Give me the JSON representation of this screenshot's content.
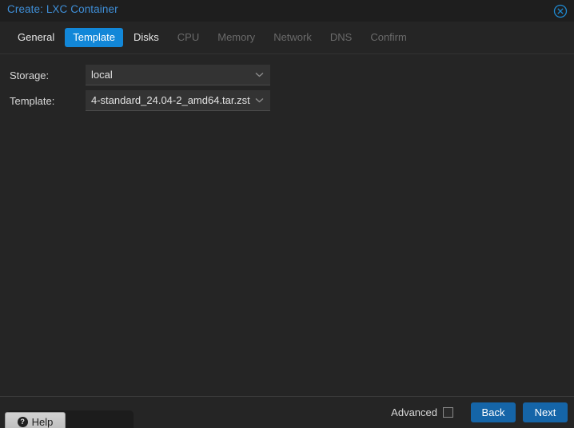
{
  "window": {
    "title": "Create: LXC Container",
    "close_icon": "close-circle-icon"
  },
  "tabs": [
    {
      "label": "General",
      "state": "enabled"
    },
    {
      "label": "Template",
      "state": "active"
    },
    {
      "label": "Disks",
      "state": "enabled"
    },
    {
      "label": "CPU",
      "state": "disabled"
    },
    {
      "label": "Memory",
      "state": "disabled"
    },
    {
      "label": "Network",
      "state": "disabled"
    },
    {
      "label": "DNS",
      "state": "disabled"
    },
    {
      "label": "Confirm",
      "state": "disabled"
    }
  ],
  "form": {
    "storage": {
      "label": "Storage:",
      "value": "local",
      "chevron_icon": "chevron-down-icon"
    },
    "template": {
      "label": "Template:",
      "value": "4-standard_24.04-2_amd64.tar.zst",
      "chevron_icon": "chevron-down-icon"
    }
  },
  "footer": {
    "help_label": "Help",
    "help_icon": "question-mark-icon",
    "advanced_label": "Advanced",
    "advanced_checked": false,
    "back_label": "Back",
    "next_label": "Next"
  },
  "colors": {
    "accent_blue": "#1287d8",
    "title_blue": "#3f8fd8",
    "button_blue": "#1565a8",
    "dialog_bg": "#252525",
    "header_bg": "#1e1e1e",
    "field_bg": "#333333",
    "disabled_text": "#6a6a6a"
  }
}
